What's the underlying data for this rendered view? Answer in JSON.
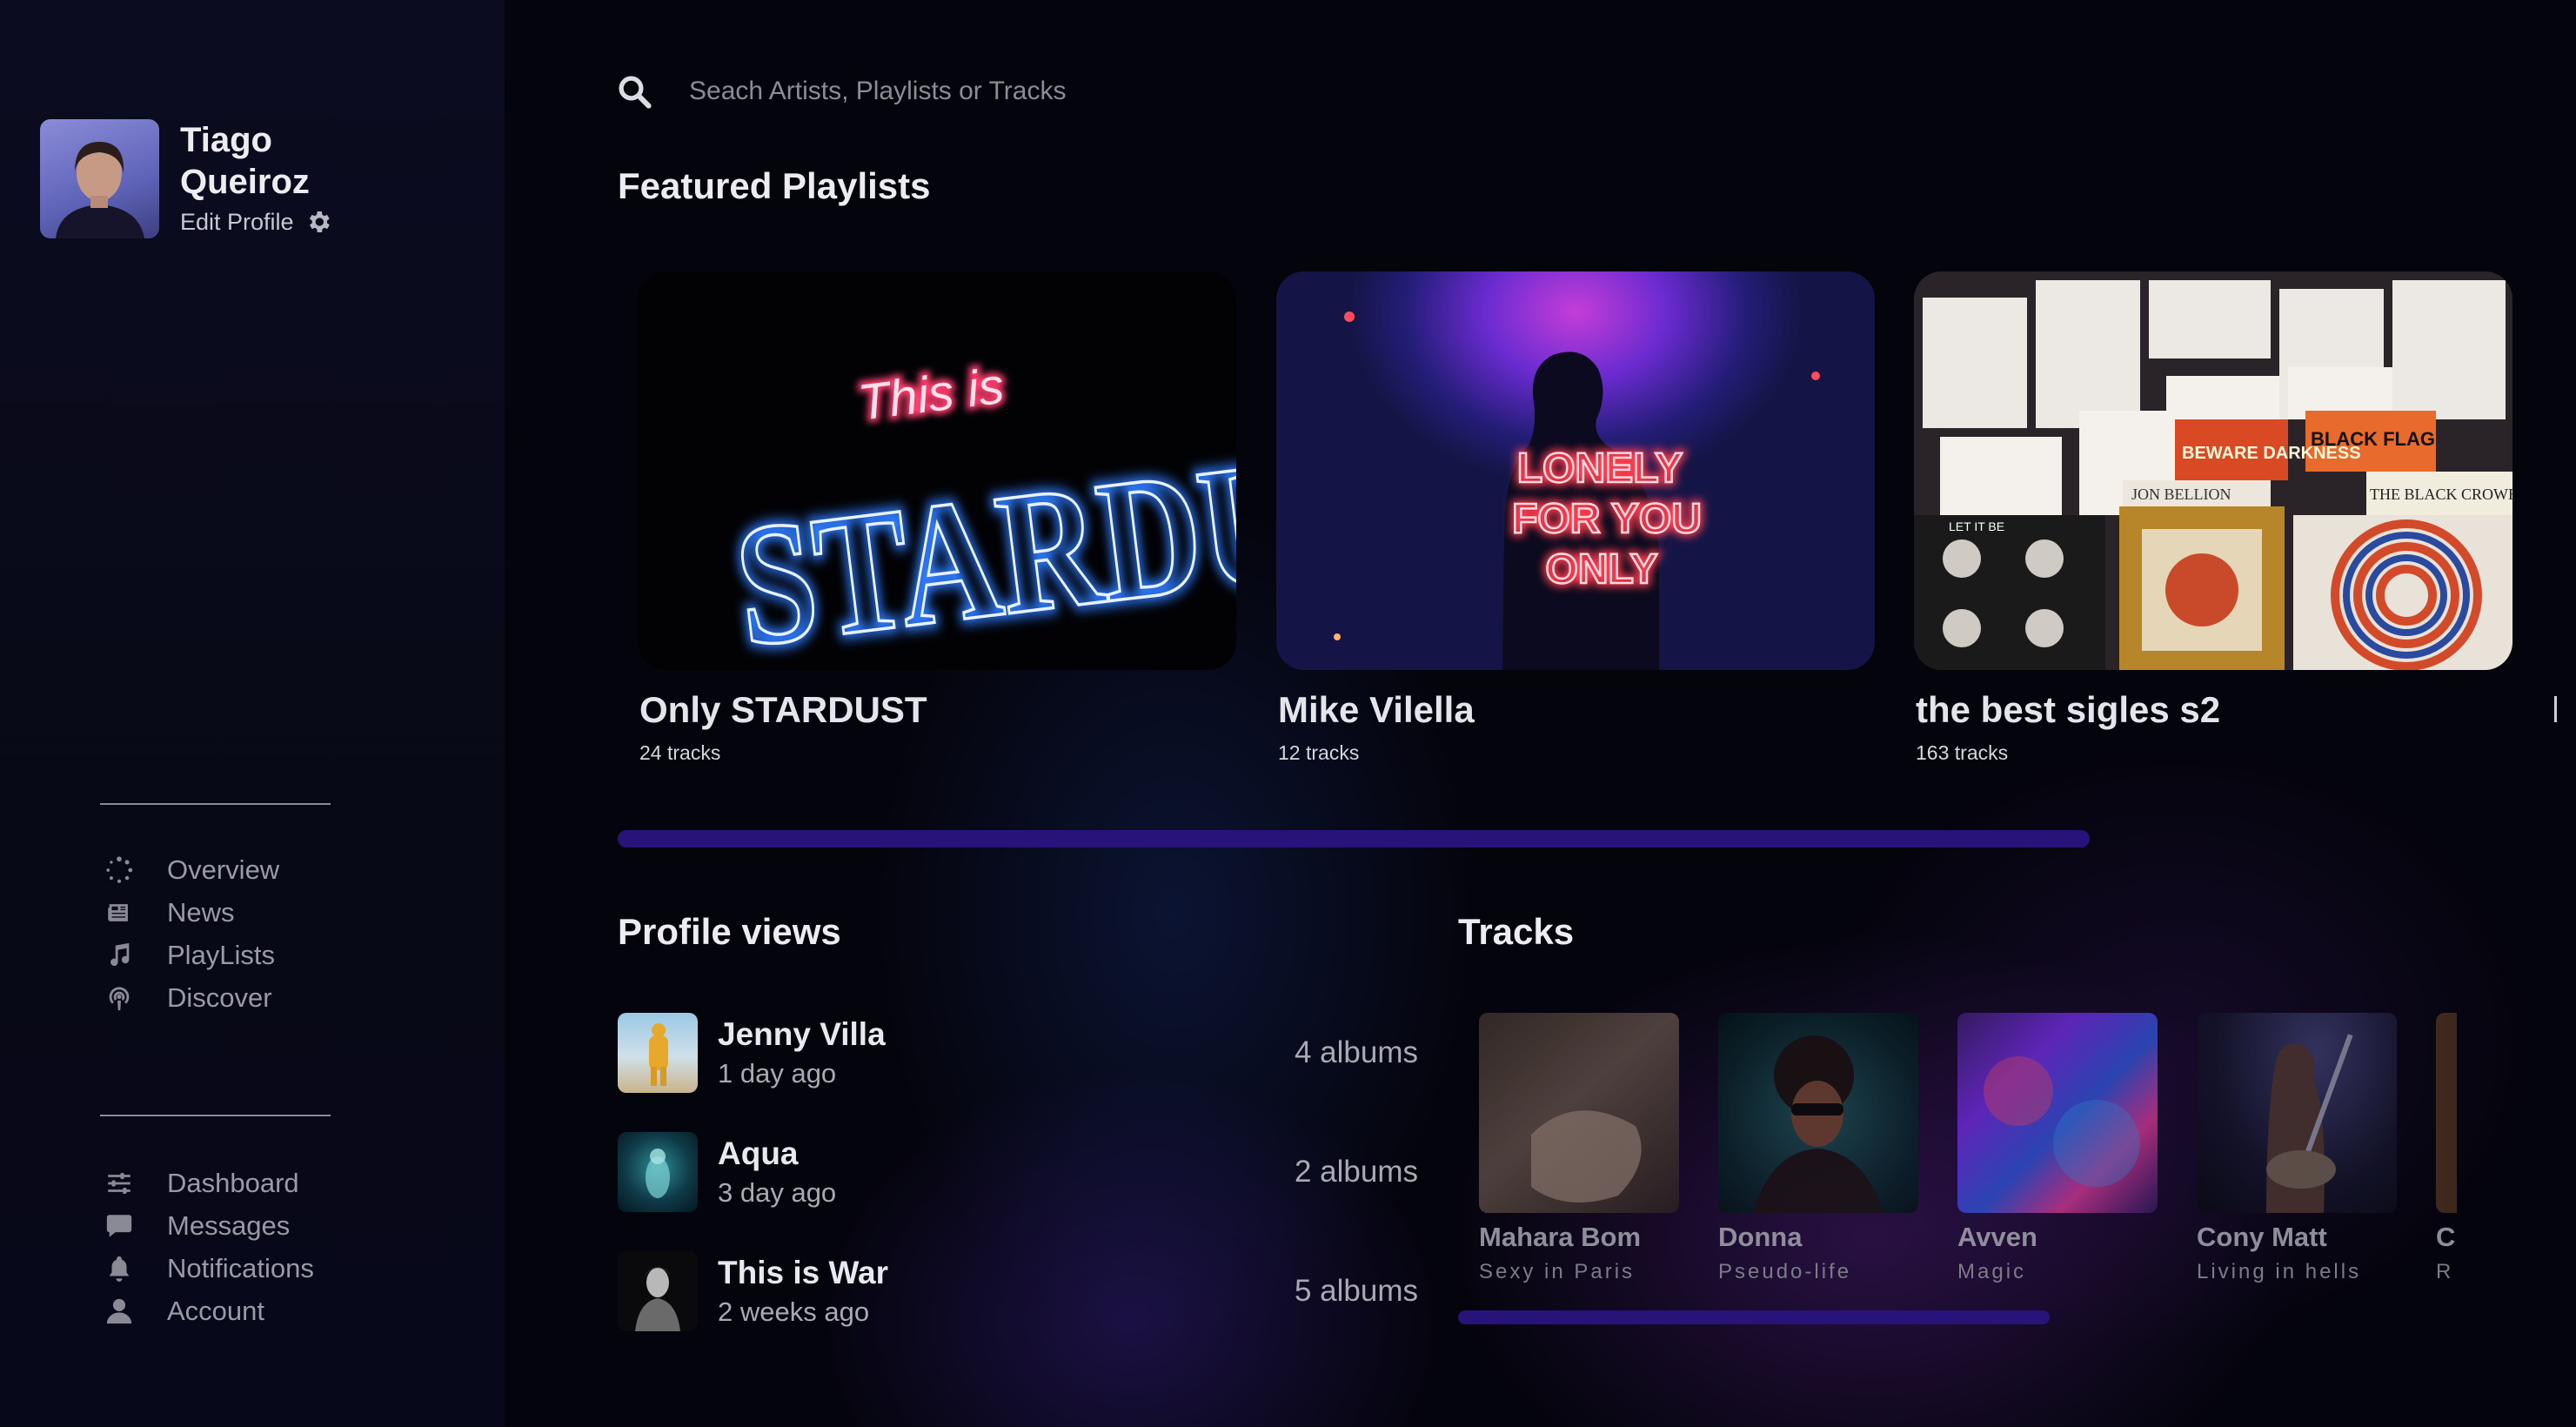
{
  "profile": {
    "name": "Tiago Queiroz",
    "edit_label": "Edit Profile"
  },
  "nav_primary": [
    {
      "label": "Overview",
      "icon": "spinner-icon"
    },
    {
      "label": "News",
      "icon": "newspaper-icon"
    },
    {
      "label": "PlayLists",
      "icon": "music-note-icon"
    },
    {
      "label": "Discover",
      "icon": "podcast-icon"
    }
  ],
  "nav_secondary": [
    {
      "label": "Dashboard",
      "icon": "sliders-icon"
    },
    {
      "label": "Messages",
      "icon": "chat-bubble-icon"
    },
    {
      "label": "Notifications",
      "icon": "bell-icon"
    },
    {
      "label": "Account",
      "icon": "user-icon"
    }
  ],
  "search": {
    "placeholder": "Seach Artists, Playlists or Tracks"
  },
  "featured": {
    "title": "Featured Playlists",
    "items": [
      {
        "title": "Only STARDUST",
        "tracks": "24 tracks",
        "cover_text_small": "This is",
        "cover_text_big": "STARDUST"
      },
      {
        "title": "Mike Vilella",
        "tracks": "12 tracks",
        "cover_lines": [
          "LONELY",
          "FOR YOU",
          "ONLY"
        ]
      },
      {
        "title": "the best sigles s2",
        "tracks": "163 tracks",
        "record_labels": [
          "BEWARE DARKNESS",
          "BLACK FLAG",
          "THE BLACK CROWES",
          "LET IT BE",
          "JON BELLION"
        ]
      }
    ]
  },
  "profile_views": {
    "title": "Profile views",
    "items": [
      {
        "name": "Jenny Villa",
        "time": "1 day ago",
        "albums": "4 albums"
      },
      {
        "name": "Aqua",
        "time": "3 day ago",
        "albums": "2 albums"
      },
      {
        "name": "This is War",
        "time": "2 weeks ago",
        "albums": "5 albums"
      }
    ]
  },
  "tracks": {
    "title": "Tracks",
    "items": [
      {
        "name": "Mahara Bom",
        "sub": "Sexy in Paris"
      },
      {
        "name": "Donna",
        "sub": "Pseudo-life"
      },
      {
        "name": "Avven",
        "sub": "Magic"
      },
      {
        "name": "Cony Matt",
        "sub": "Living in hells"
      },
      {
        "name": "C",
        "sub": "R"
      }
    ]
  },
  "colors": {
    "accent": "#27137a",
    "background": "#04040c",
    "neon_pink": "#ff3d6e",
    "neon_blue": "#4aa8ff"
  }
}
